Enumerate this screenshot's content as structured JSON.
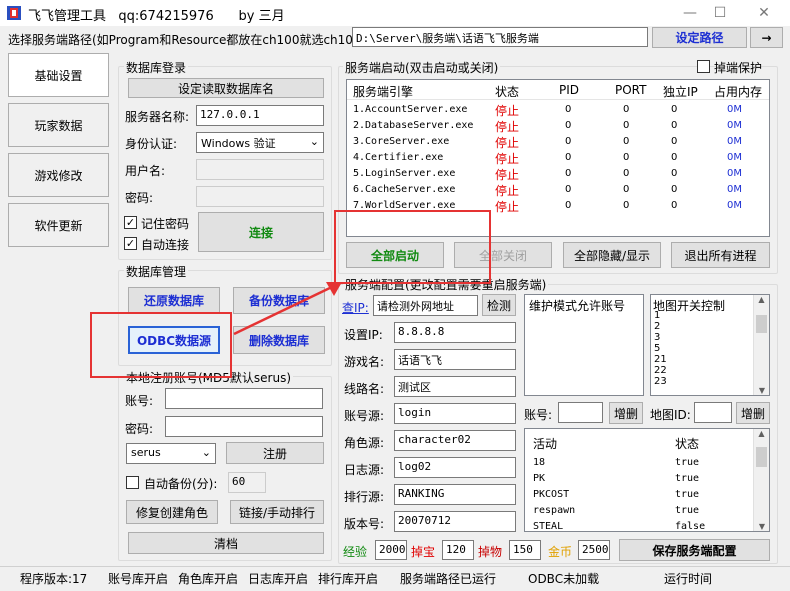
{
  "window": {
    "title": "飞飞管理工具   qq:674215976      by 三月",
    "minimize": "—",
    "maximize": "☐",
    "close": "✕"
  },
  "pathbar": {
    "label": "选择服务端路径(如Program和Resource都放在ch100就选ch100):",
    "value": "D:\\Server\\服务端\\话语飞飞服务端",
    "set_button": "设定路径",
    "arrow_button": "→"
  },
  "tabs": [
    "基础设置",
    "玩家数据",
    "游戏修改",
    "软件更新"
  ],
  "db_login": {
    "group": "数据库登录",
    "read_button": "设定读取数据库名",
    "server_label": "服务器名称:",
    "server_value": "127.0.0.1",
    "auth_label": "身份认证:",
    "auth_value": "Windows 验证",
    "user_label": "用户名:",
    "pass_label": "密码:",
    "remember_label": "记住密码",
    "autoconnect_label": "自动连接",
    "connect_button": "连接"
  },
  "db_manage": {
    "group": "数据库管理",
    "restore": "还原数据库",
    "backup": "备份数据库",
    "odbc": "ODBC数据源",
    "delete": "删除数据库"
  },
  "local_reg": {
    "group": "本地注册账号(MD5默认serus)",
    "account_label": "账号:",
    "password_label": "密码:",
    "select_value": "serus",
    "register_button": "注册",
    "autobackup_label": "自动备份(分):",
    "autobackup_value": "60",
    "repair_button": "修复创建角色",
    "link_button": "链接/手动排行",
    "clear_button": "清档"
  },
  "server_start": {
    "group": "服务端启动(双击启动或关闭)",
    "protect_label": "掉端保护",
    "columns": [
      "服务端引擎",
      "状态",
      "PID",
      "PORT",
      "独立IP",
      "占用内存"
    ],
    "rows": [
      {
        "name": "1.AccountServer.exe",
        "status": "停止",
        "pid": "0",
        "port": "0",
        "ip": "0",
        "mem": "0M"
      },
      {
        "name": "2.DatabaseServer.exe",
        "status": "停止",
        "pid": "0",
        "port": "0",
        "ip": "0",
        "mem": "0M"
      },
      {
        "name": "3.CoreServer.exe",
        "status": "停止",
        "pid": "0",
        "port": "0",
        "ip": "0",
        "mem": "0M"
      },
      {
        "name": "4.Certifier.exe",
        "status": "停止",
        "pid": "0",
        "port": "0",
        "ip": "0",
        "mem": "0M"
      },
      {
        "name": "5.LoginServer.exe",
        "status": "停止",
        "pid": "0",
        "port": "0",
        "ip": "0",
        "mem": "0M"
      },
      {
        "name": "6.CacheServer.exe",
        "status": "停止",
        "pid": "0",
        "port": "0",
        "ip": "0",
        "mem": "0M"
      },
      {
        "name": "7.WorldServer.exe",
        "status": "停止",
        "pid": "0",
        "port": "0",
        "ip": "0",
        "mem": "0M"
      }
    ],
    "start_all": "全部启动",
    "stop_all": "全部关闭",
    "hide_show": "全部隐藏/显示",
    "exit_all": "退出所有进程"
  },
  "server_config": {
    "group": "服务端配置(更改配置需要重启服务端)",
    "ip_query_label": "查IP:",
    "ip_query_value": "请检测外网地址",
    "detect_button": "检测",
    "set_ip_label": "设置IP:",
    "set_ip_value": "8.8.8.8",
    "game_name_label": "游戏名:",
    "game_name_value": "话语飞飞",
    "line_label": "线路名:",
    "line_value": "测试区",
    "account_src_label": "账号源:",
    "account_src_value": "login",
    "role_src_label": "角色源:",
    "role_src_value": "character02",
    "log_src_label": "日志源:",
    "log_src_value": "log02",
    "rank_src_label": "排行源:",
    "rank_src_value": "RANKING",
    "version_label": "版本号:",
    "version_value": "20070712",
    "whitelist_title": "维护模式允许账号",
    "map_title": "地图开关控制",
    "map_items": [
      "1",
      "2",
      "3",
      "5",
      "21",
      "22",
      "23"
    ],
    "acct_label": "账号:",
    "acct_add": "增删",
    "mapid_label": "地图ID:",
    "mapid_add": "增删",
    "activity_header": "活动",
    "activity_status_header": "状态",
    "activities": [
      {
        "name": "18",
        "status": "true"
      },
      {
        "name": "PK",
        "status": "true"
      },
      {
        "name": "PKCOST",
        "status": "true"
      },
      {
        "name": "respawn",
        "status": "true"
      },
      {
        "name": "STEAL",
        "status": "false"
      }
    ],
    "exp_label": "经验",
    "exp_value": "2000",
    "drop_label": "掉宝",
    "drop_value": "120",
    "item_label": "掉物",
    "item_value": "150",
    "gold_label": "金币",
    "gold_value": "2500",
    "save_button": "保存服务端配置",
    "colors": {
      "exp": "#118a11",
      "drop": "#e00000",
      "item": "#c80000",
      "gold": "#e0a000"
    }
  },
  "statusbar": [
    "程序版本:17",
    "账号库开启",
    "角色库开启",
    "日志库开启",
    "排行库开启",
    "服务端路径已运行",
    "ODBC未加载",
    "运行时间"
  ]
}
